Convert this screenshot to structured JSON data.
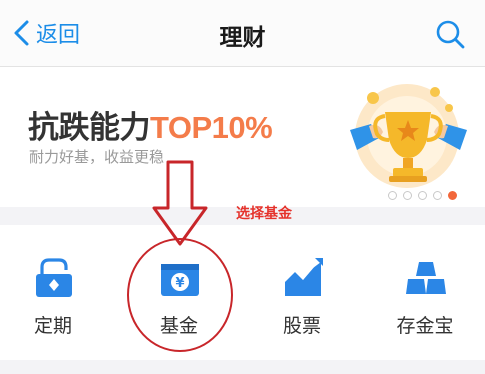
{
  "navbar": {
    "back_label": "返回",
    "title": "理财"
  },
  "banner": {
    "headline_main": "抗跌能力",
    "headline_highlight": "TOP10%",
    "subline": "耐力好基，收益更稳",
    "carousel_dots": 5,
    "active_dot": 5
  },
  "annotation": {
    "text": "选择基金",
    "color": "#e5322b"
  },
  "menu": {
    "items": [
      {
        "label": "定期",
        "icon": "lock-coin-icon"
      },
      {
        "label": "基金",
        "icon": "yen-box-icon"
      },
      {
        "label": "股票",
        "icon": "trend-chart-icon"
      },
      {
        "label": "存金宝",
        "icon": "gold-bars-icon"
      }
    ]
  },
  "colors": {
    "accent": "#1c8de8",
    "icon_blue": "#2b86e6",
    "headline_highlight": "#f47c4a",
    "annotation_red": "#c8262a"
  }
}
